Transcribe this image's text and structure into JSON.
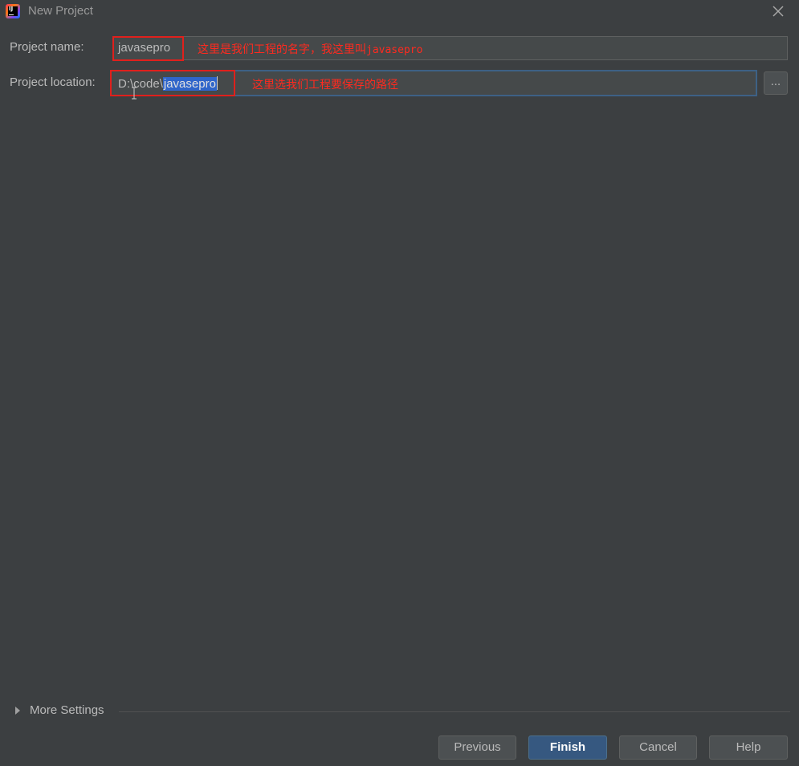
{
  "window": {
    "title": "New Project"
  },
  "form": {
    "project_name_label": "Project name:",
    "project_name_value": "javasepro",
    "project_location_label": "Project location:",
    "project_location_prefix": "D:\\code\\",
    "project_location_selected": "javasepro",
    "browse_label": "..."
  },
  "annotations": {
    "name_note_text": "这里是我们工程的名字，我这里叫",
    "name_note_code": "javasepro",
    "location_note": "这里选我们工程要保存的路径"
  },
  "more_settings": {
    "label": "More Settings"
  },
  "buttons": {
    "previous": "Previous",
    "finish": "Finish",
    "cancel": "Cancel",
    "help": "Help"
  },
  "colors": {
    "background": "#3c3f41",
    "annotation_red": "#e0201c",
    "primary_button": "#365880",
    "focus_border": "#3d6185",
    "selection": "#2f65ca"
  }
}
